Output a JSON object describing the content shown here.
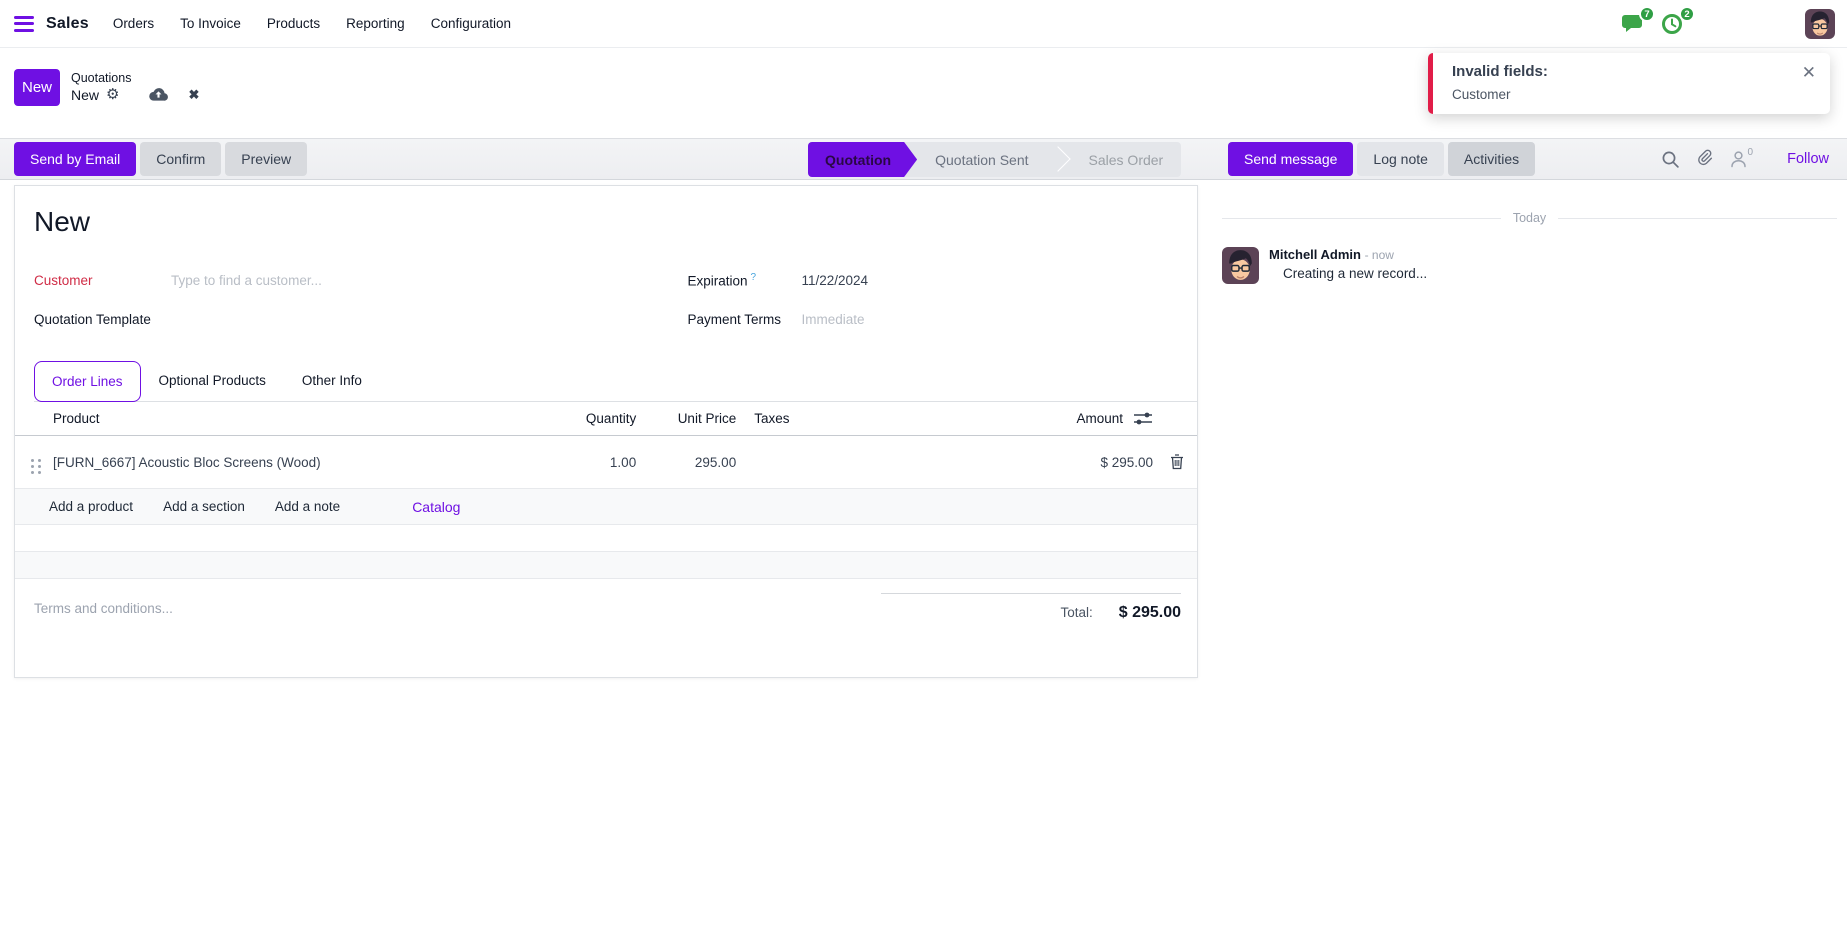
{
  "app": {
    "name": "Sales",
    "menu": [
      "Orders",
      "To Invoice",
      "Products",
      "Reporting",
      "Configuration"
    ],
    "messages_badge": "7",
    "activities_badge": "2"
  },
  "breadcrumb": {
    "new_button": "New",
    "parent": "Quotations",
    "current": "New"
  },
  "toast": {
    "title": "Invalid fields:",
    "body": "Customer",
    "close": "✕"
  },
  "actionbar": {
    "send_by_email": "Send by Email",
    "confirm": "Confirm",
    "preview": "Preview",
    "statusbar": [
      "Quotation",
      "Quotation Sent",
      "Sales Order"
    ],
    "active_status": "Quotation"
  },
  "chatter": {
    "send_message": "Send message",
    "log_note": "Log note",
    "activities": "Activities",
    "followers_count": "0",
    "follow": "Follow",
    "divider": "Today",
    "message": {
      "author": "Mitchell Admin",
      "time": "- now",
      "body": "Creating a new record..."
    }
  },
  "form": {
    "title": "New",
    "customer": {
      "label": "Customer",
      "placeholder": "Type to find a customer..."
    },
    "quotation_template": {
      "label": "Quotation Template"
    },
    "expiration": {
      "label": "Expiration",
      "help": "?",
      "value": "11/22/2024"
    },
    "payment_terms": {
      "label": "Payment Terms",
      "placeholder": "Immediate"
    },
    "tabs": [
      "Order Lines",
      "Optional Products",
      "Other Info"
    ],
    "active_tab": "Order Lines",
    "table": {
      "headers": {
        "product": "Product",
        "quantity": "Quantity",
        "unit_price": "Unit Price",
        "taxes": "Taxes",
        "amount": "Amount"
      },
      "rows": [
        {
          "product": "[FURN_6667] Acoustic Bloc Screens (Wood)",
          "quantity": "1.00",
          "unit_price": "295.00",
          "taxes": "",
          "amount": "$ 295.00"
        }
      ],
      "add_product": "Add a product",
      "add_section": "Add a section",
      "add_note": "Add a note",
      "catalog": "Catalog"
    },
    "terms_placeholder": "Terms and conditions...",
    "total": {
      "label": "Total:",
      "value": "$ 295.00"
    }
  },
  "colors": {
    "primary": "#6f10e3",
    "danger": "#d02c46",
    "success": "#2f9e44"
  }
}
